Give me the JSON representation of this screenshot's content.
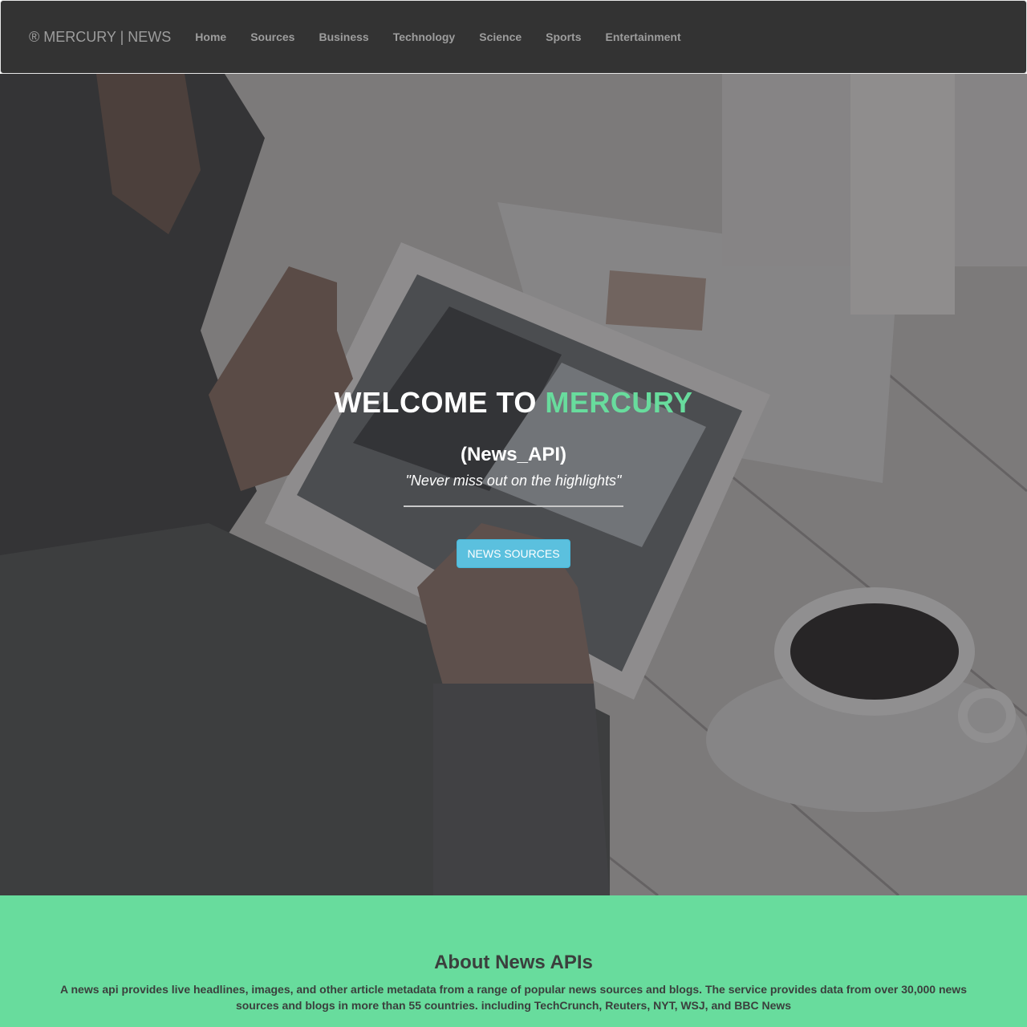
{
  "navbar": {
    "brand": "® MERCURY | NEWS",
    "items": [
      {
        "label": "Home"
      },
      {
        "label": "Sources"
      },
      {
        "label": "Business"
      },
      {
        "label": "Technology"
      },
      {
        "label": "Science"
      },
      {
        "label": "Sports"
      },
      {
        "label": "Entertainment"
      }
    ]
  },
  "hero": {
    "title_prefix": "WELCOME TO ",
    "title_accent": "MERCURY",
    "subtitle": "(News_API)",
    "tagline": "\"Never miss out on the highlights\"",
    "button_label": "NEWS SOURCES"
  },
  "about": {
    "title": "About News APIs",
    "text": "A news api provides live headlines, images, and other article metadata from a range of popular news sources and blogs. The service provides data from over 30,000 news sources and blogs in more than 55 countries. including TechCrunch, Reuters, NYT, WSJ, and BBC News"
  },
  "colors": {
    "navbar_bg": "#333333",
    "nav_text": "#9d9d9d",
    "accent_green": "#68dc9d",
    "button_bg": "#5bc0de"
  }
}
